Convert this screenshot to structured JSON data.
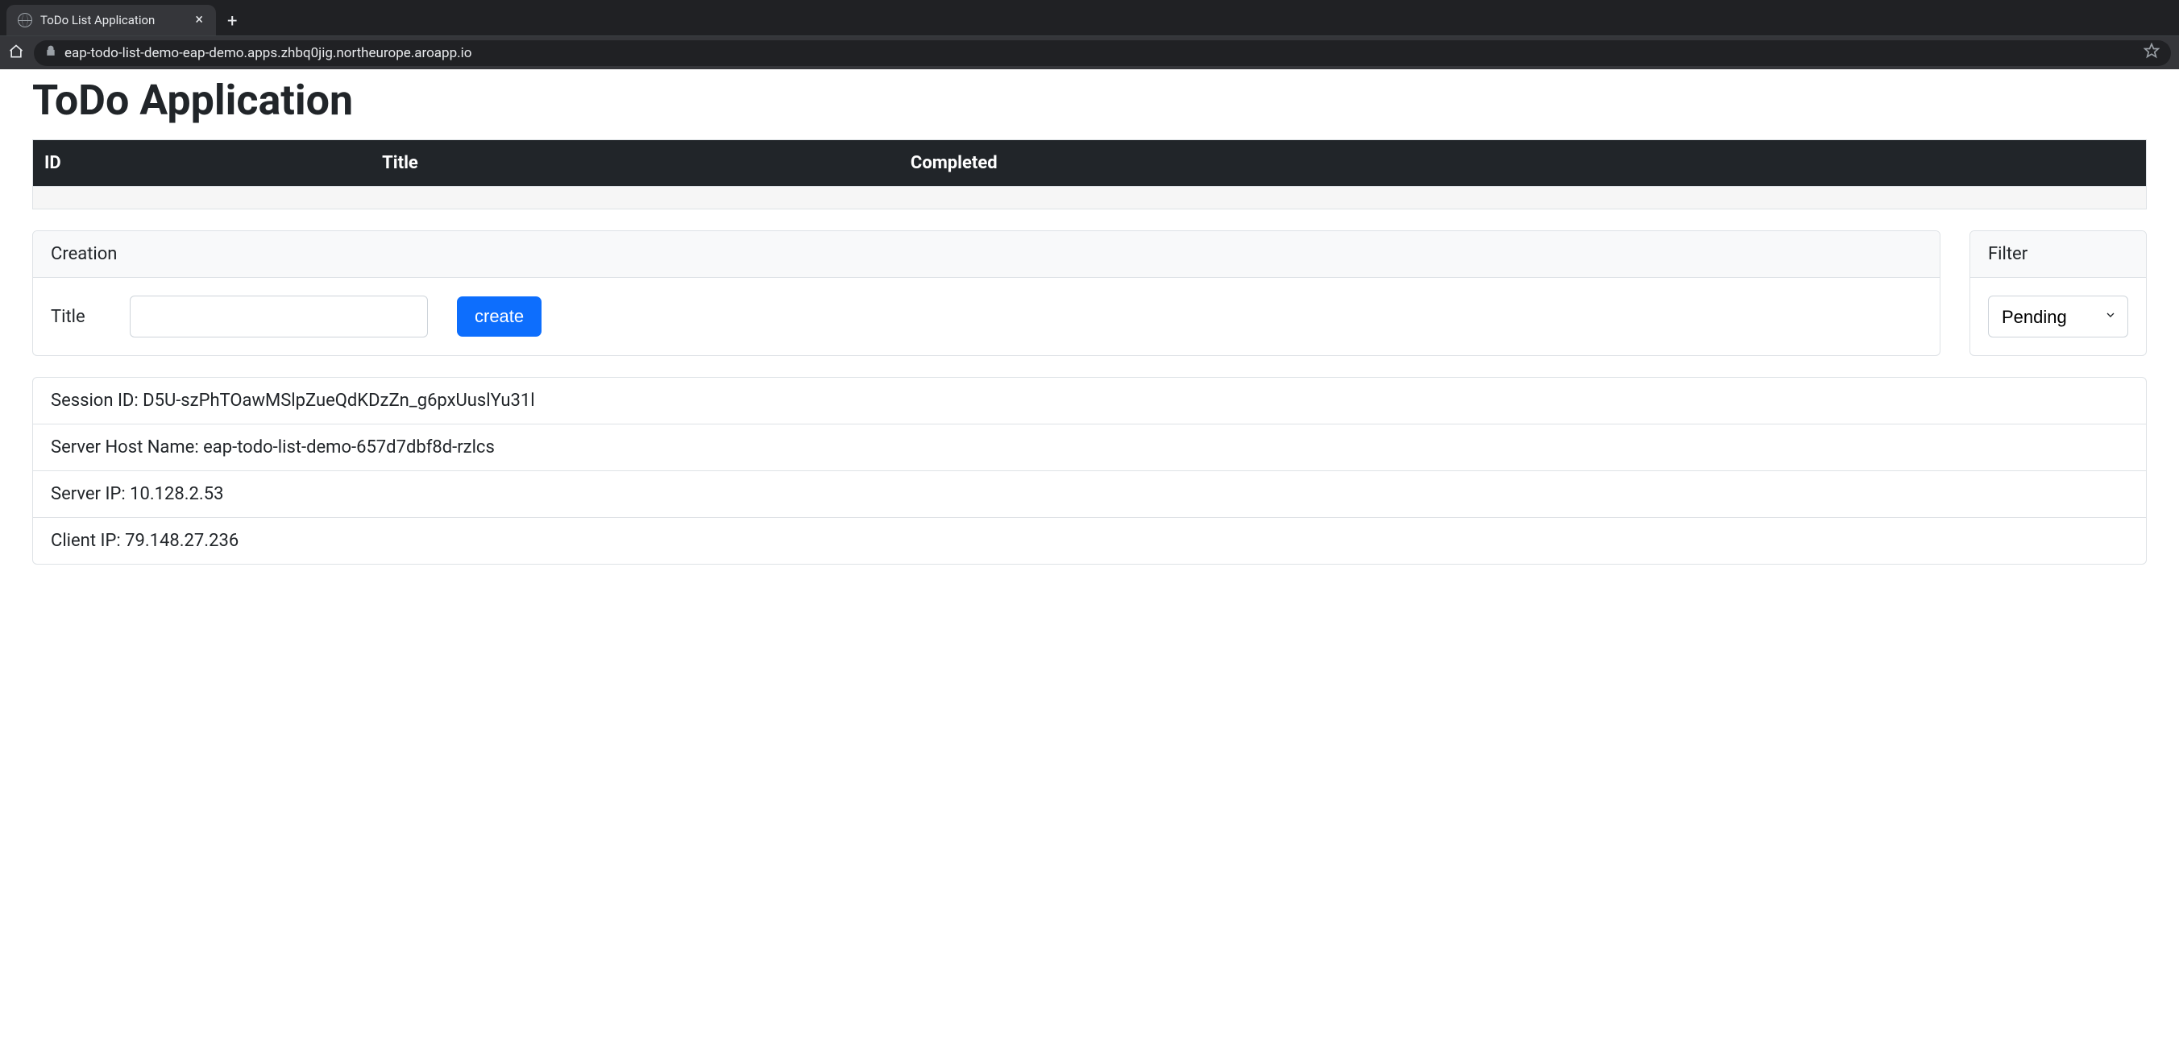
{
  "browser": {
    "tab_title": "ToDo List Application",
    "url": "eap-todo-list-demo-eap-demo.apps.zhbq0jig.northeurope.aroapp.io"
  },
  "page": {
    "title": "ToDo Application"
  },
  "table": {
    "headers": {
      "id": "ID",
      "title": "Title",
      "completed": "Completed"
    }
  },
  "creation": {
    "header": "Creation",
    "title_label": "Title",
    "title_value": "",
    "button_label": "create"
  },
  "filter": {
    "header": "Filter",
    "selected": "Pending"
  },
  "info": {
    "session_id": "Session ID: D5U-szPhTOawMSlpZueQdKDzZn_g6pxUuslYu31l",
    "server_host": "Server Host Name: eap-todo-list-demo-657d7dbf8d-rzlcs",
    "server_ip": "Server IP: 10.128.2.53",
    "client_ip": "Client IP: 79.148.27.236"
  }
}
